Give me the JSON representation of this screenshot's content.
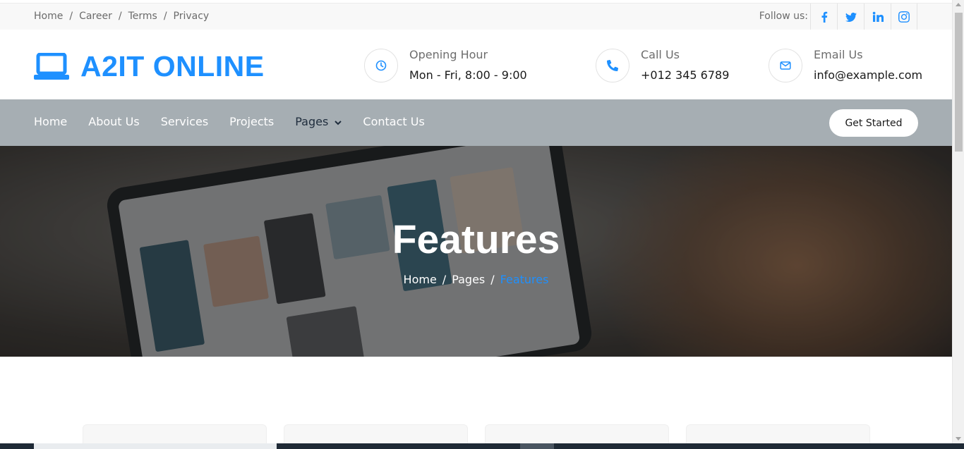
{
  "topbar": {
    "links": [
      "Home",
      "Career",
      "Terms",
      "Privacy"
    ],
    "separator": "/",
    "follow_label": "Follow us:",
    "socials": [
      "facebook-icon",
      "twitter-icon",
      "linkedin-icon",
      "instagram-icon"
    ]
  },
  "header": {
    "logo_text": "A2IT ONLINE",
    "opening": {
      "label": "Opening Hour",
      "value": "Mon - Fri, 8:00 - 9:00"
    },
    "call": {
      "label": "Call Us",
      "value": "+012 345 6789"
    },
    "email": {
      "label": "Email Us",
      "value": "info@example.com"
    }
  },
  "nav": {
    "items": [
      "Home",
      "About Us",
      "Services",
      "Projects",
      "Pages",
      "Contact Us"
    ],
    "cta": "Get Started"
  },
  "hero": {
    "title": "Features",
    "breadcrumb": [
      "Home",
      "Pages",
      "Features"
    ]
  },
  "colors": {
    "accent": "#1e90ff",
    "nav_bg": "#a6aeb3",
    "topbar_bg": "#f8f8f8"
  }
}
